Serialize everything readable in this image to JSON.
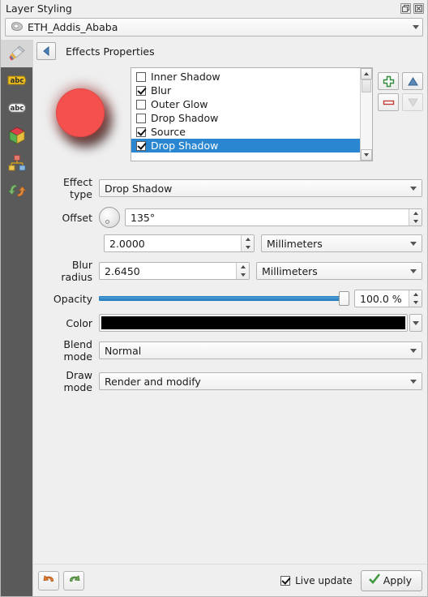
{
  "titlebar": {
    "title": "Layer Styling",
    "float_icon": "float-window-icon",
    "close_icon": "close-icon"
  },
  "layer_selector": {
    "icon": "polygon-layer-icon",
    "name": "ETH_Addis_Ababa"
  },
  "sidebar": {
    "items": [
      {
        "icon": "paintbrush-icon",
        "name": "symbology",
        "active": true
      },
      {
        "icon": "labels-abc-icon",
        "name": "labels",
        "active": false
      },
      {
        "icon": "masks-abc-icon",
        "name": "masks",
        "active": false
      },
      {
        "icon": "3d-view-cube-icon",
        "name": "3d-view",
        "active": false
      },
      {
        "icon": "diagram-icon",
        "name": "diagrams",
        "active": false
      },
      {
        "icon": "actions-arrows-icon",
        "name": "actions",
        "active": false
      }
    ]
  },
  "effects_header": {
    "back_icon": "back-arrow-icon",
    "title": "Effects Properties"
  },
  "preview": {
    "shape": "circle",
    "fill_color": "#f4514e",
    "glow_color": "#e6403c",
    "shadow_color": "#231412"
  },
  "effects_list": {
    "items": [
      {
        "label": "Inner Shadow",
        "checked": false,
        "selected": false
      },
      {
        "label": "Blur",
        "checked": true,
        "selected": false
      },
      {
        "label": "Outer Glow",
        "checked": false,
        "selected": false
      },
      {
        "label": "Drop Shadow",
        "checked": false,
        "selected": false
      },
      {
        "label": "Source",
        "checked": true,
        "selected": false
      },
      {
        "label": "Drop Shadow",
        "checked": true,
        "selected": true
      }
    ],
    "selection_color": "#2a86d0"
  },
  "list_buttons": [
    {
      "name": "add-effect-button",
      "icon": "plus-icon",
      "enabled": true
    },
    {
      "name": "move-up-button",
      "icon": "triangle-up-icon",
      "enabled": true
    },
    {
      "name": "remove-effect-button",
      "icon": "minus-icon",
      "enabled": true
    },
    {
      "name": "move-down-button",
      "icon": "triangle-down-icon",
      "enabled": false
    }
  ],
  "form": {
    "effect_type": {
      "label": "Effect type",
      "value": "Drop Shadow"
    },
    "offset": {
      "label": "Offset",
      "angle": "135°",
      "distance": "2.0000",
      "distance_unit": "Millimeters"
    },
    "blur_radius": {
      "label": "Blur radius",
      "value": "2.6450",
      "unit": "Millimeters"
    },
    "opacity": {
      "label": "Opacity",
      "value": "100.0 %",
      "percent": 100
    },
    "color": {
      "label": "Color",
      "value": "#000000"
    },
    "blend_mode": {
      "label": "Blend mode",
      "value": "Normal"
    },
    "draw_mode": {
      "label": "Draw mode",
      "value": "Render and modify"
    }
  },
  "footer": {
    "undo_icon": "undo-arrow-icon",
    "redo_icon": "redo-arrow-icon",
    "live_update": {
      "label": "Live update",
      "checked": true
    },
    "apply": {
      "label": "Apply",
      "icon": "green-check-icon"
    }
  }
}
